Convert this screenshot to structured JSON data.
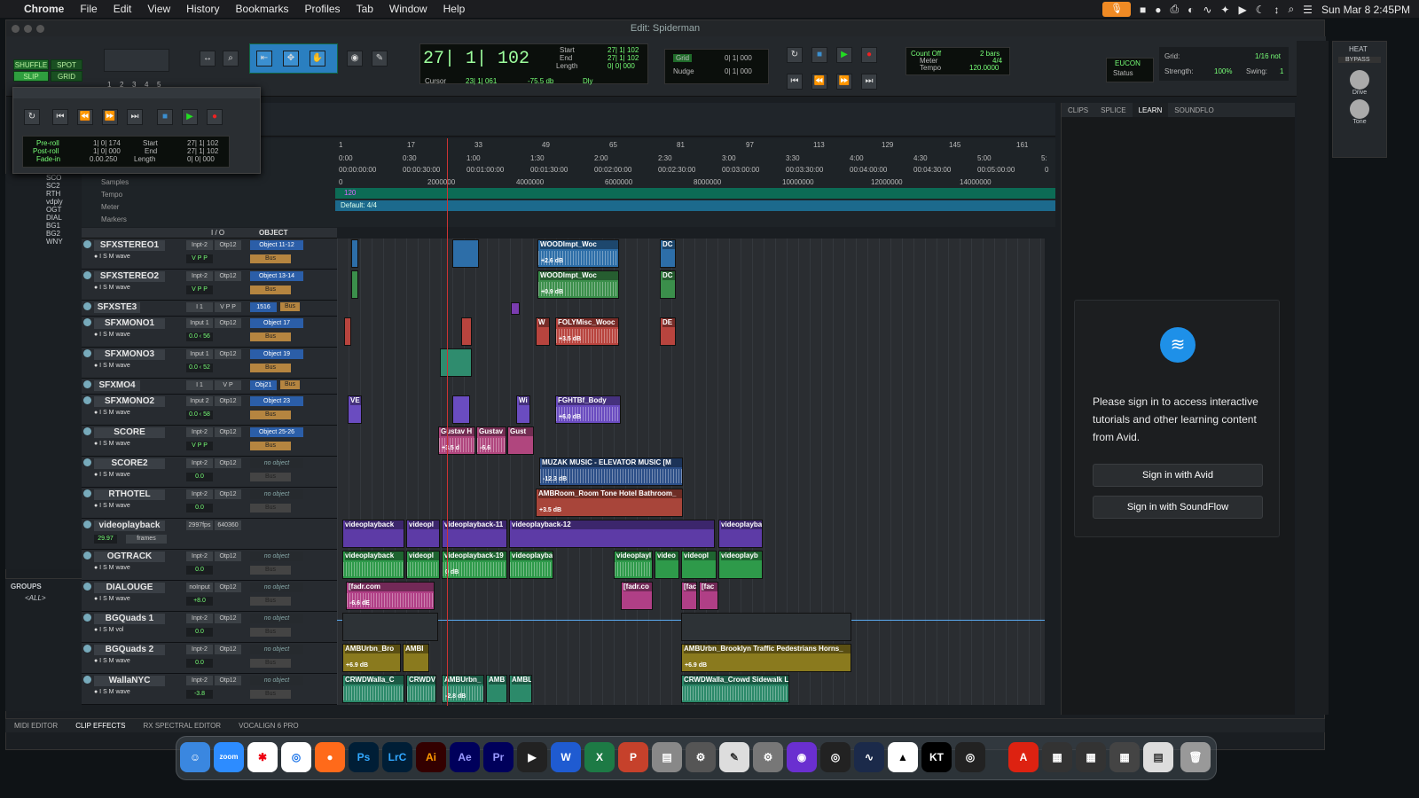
{
  "menubar": {
    "apple": "",
    "app": "Chrome",
    "items": [
      "File",
      "Edit",
      "View",
      "History",
      "Bookmarks",
      "Profiles",
      "Tab",
      "Window",
      "Help"
    ],
    "datetime": "Sun Mar 8  2:45PM"
  },
  "window": {
    "title": "Edit: Spiderman",
    "behind_title": "derman"
  },
  "toolbar": {
    "modes": {
      "shuffle": "SHUFFLE",
      "spot": "SPOT",
      "slip": "SLIP",
      "grid": "GRID"
    },
    "zoom_presets": [
      "1",
      "2",
      "3",
      "4",
      "5"
    ],
    "main_counter": "27| 1| 102",
    "start_label": "Start",
    "end_label": "End",
    "length_label": "Length",
    "start_val": "27| 1| 102",
    "end_val": "27| 1| 102",
    "length_val": "0| 0| 000",
    "cursor_label": "Cursor",
    "cursor_val": "23| 1| 061",
    "cursor_db": "-75.5 db",
    "dly": "Dly",
    "grid_label": "Grid",
    "grid_val": "0| 1| 000",
    "nudge_label": "Nudge",
    "nudge_val": "0| 1| 000",
    "count_off": "Count Off",
    "meter": "Meter",
    "tempo": "Tempo",
    "count_off_val": "2 bars",
    "meter_val": "4/4",
    "tempo_val": "120.0000",
    "eucon": "EUCON",
    "status": "Status",
    "grid2_label": "Grid:",
    "grid2_val": "1/16 not",
    "strength_label": "Strength:",
    "strength_val": "100%",
    "swing_label": "Swing:",
    "swing_val": "1"
  },
  "transport": {
    "preroll_label": "Pre-roll",
    "postroll_label": "Post-roll",
    "fadein_label": "Fade-in",
    "preroll_val": "1| 0| 174",
    "postroll_val": "1| 0| 000",
    "fadein_val": "0.00.250",
    "start_label": "Start",
    "end_label": "End",
    "length_label": "Length",
    "start_val": "27| 1| 102",
    "end_val": "27| 1| 102",
    "length_val": "0| 0| 000"
  },
  "ruler": {
    "labels": {
      "samples": "Samples",
      "tempo": "Tempo",
      "meter": "Meter",
      "markers": "Markers"
    },
    "bars": [
      "1",
      "17",
      "33",
      "49",
      "65",
      "81",
      "97",
      "113",
      "129",
      "145",
      "161"
    ],
    "mins": [
      "0:00",
      "0:30",
      "1:00",
      "1:30",
      "2:00",
      "2:30",
      "3:00",
      "3:30",
      "4:00",
      "4:30",
      "5:00",
      "5:"
    ],
    "tc": [
      "00:00:00:00",
      "00:00:30:00",
      "00:01:00:00",
      "00:01:30:00",
      "00:02:00:00",
      "00:02:30:00",
      "00:03:00:00",
      "00:03:30:00",
      "00:04:00:00",
      "00:04:30:00",
      "00:05:00:00",
      "0"
    ],
    "samples": [
      "0",
      "2000000",
      "4000000",
      "6000000",
      "8000000",
      "10000000",
      "12000000",
      "14000000"
    ],
    "tempo_val": "120",
    "meter_val": "Default: 4/4"
  },
  "cliplist": {
    "items": [
      "SCO",
      "SC2",
      "RTH",
      "vdply",
      "OGT",
      "DIAL",
      "BG1",
      "BG2",
      "WNY"
    ],
    "groups_label": "GROUPS",
    "all_group": "<ALL>"
  },
  "track_header": {
    "io": "I / O",
    "object": "OBJECT"
  },
  "tracks": [
    {
      "name": "SFXSTEREO1",
      "in": "Inpt-2",
      "out": "Otp12",
      "obj": "Object 11-12",
      "vol": "V P P",
      "bus": "Bus"
    },
    {
      "name": "SFXSTEREO2",
      "in": "Inpt-2",
      "out": "Otp12",
      "obj": "Object 13-14",
      "vol": "V P P",
      "bus": "Bus"
    },
    {
      "name": "SFXSTE3",
      "in": "I 1",
      "out": "V P P",
      "obj": "1516",
      "vol": "",
      "bus": "Bus"
    },
    {
      "name": "SFXMONO1",
      "in": "Input 1",
      "out": "Otp12",
      "obj": "Object 17",
      "vol": "0.0  ‹ 56",
      "bus": "Bus"
    },
    {
      "name": "SFXMONO3",
      "in": "Input 1",
      "out": "Otp12",
      "obj": "Object 19",
      "vol": "0.0  ‹ 52",
      "bus": "Bus"
    },
    {
      "name": "SFXMO4",
      "in": "I 1",
      "out": "V P",
      "obj": "Obj21",
      "vol": "",
      "bus": "Bus"
    },
    {
      "name": "SFXMONO2",
      "in": "Input 2",
      "out": "Otp12",
      "obj": "Object 23",
      "vol": "0.0  ‹ 58",
      "bus": "Bus"
    },
    {
      "name": "SCORE",
      "in": "Inpt-2",
      "out": "Otp12",
      "obj": "Object 25-26",
      "vol": "V P P",
      "bus": "Bus"
    },
    {
      "name": "SCORE2",
      "in": "Inpt-2",
      "out": "Otp12",
      "obj": "no object",
      "vol": "0.0",
      "bus": "Bus"
    },
    {
      "name": "RTHOTEL",
      "in": "Inpt-2",
      "out": "Otp12",
      "obj": "no object",
      "vol": "0.0",
      "bus": "Bus"
    },
    {
      "name": "videoplayback",
      "in": "2997fps",
      "out": "640360",
      "obj": "",
      "vol": "29.97",
      "bus": "frames"
    },
    {
      "name": "OGTRACK",
      "in": "Inpt-2",
      "out": "Otp12",
      "obj": "no object",
      "vol": "0.0",
      "bus": "Bus"
    },
    {
      "name": "DIALOUGE",
      "in": "noInput",
      "out": "Otp12",
      "obj": "no object",
      "vol": "+8.0",
      "bus": "Bus"
    },
    {
      "name": "BGQuads 1",
      "in": "Inpt-2",
      "out": "Otp12",
      "obj": "no object",
      "vol": "0.0",
      "bus": "Bus"
    },
    {
      "name": "BGQuads 2",
      "in": "Inpt-2",
      "out": "Otp12",
      "obj": "no object",
      "vol": "0.0",
      "bus": "Bus"
    },
    {
      "name": "WallaNYC",
      "in": "Inpt-2",
      "out": "Otp12",
      "obj": "no object",
      "vol": "-3.8",
      "bus": "Bus"
    }
  ],
  "clips": {
    "c1": "WOODImpt_Woc",
    "c1g": "+2.6 dB",
    "c2": "DC",
    "c3": "WOODImpt_Woc",
    "c3g": "+0.9 dB",
    "c4": "DC",
    "c5": "FOLYMisc_Wooc",
    "c5g": "+3.5 dB",
    "c6": "W",
    "c7": "DE",
    "c8": "VE",
    "c9": "Wi",
    "c10": "FGHTBf_Body",
    "c10g": "+6.0 dB",
    "c11": "Gustav H",
    "c11g": "+3.5 d",
    "c12": "Gustav",
    "c12g": "-6.6",
    "c13": "Gust",
    "c14": "MUZAK MUSIC - ELEVATOR MUSIC [M",
    "c14g": "-12.3 dB",
    "c15": "AMBRoom_Room Tone Hotel Bathroom_",
    "c15g": "+3.5 dB",
    "v1": "videoplayback",
    "v2": "videopl",
    "v3": "videoplayback-11",
    "v4": "videoplayback-12",
    "v5": "videoplayba",
    "o1": "videoplayback",
    "o2": "videopl",
    "o3": "videoplayback-19",
    "o4": "videoplayba",
    "o5": "videoplayl",
    "o6": "video",
    "o7": "videopl",
    "o8": "videoplayb",
    "odb": "0 dB",
    "d1": "[fadr.com",
    "d1g": "-6.6 dE",
    "d2": "[fadr.co",
    "d3": "[fac",
    "d4": "[fac",
    "b1": "AMBUrbn_Bro",
    "b2": "AMBI",
    "b1g": "+6.9 dB",
    "b3": "AMBUrbn_Brooklyn Traffic Pedestrians Horns_",
    "b3g": "+6.9 dB",
    "w1": "CRWDWalla_C",
    "w2": "CRWDV",
    "w3": "AMBUrbn_",
    "w4": "AMB",
    "w5": "AMBL",
    "w3g": "-2.8 dB",
    "w6": "CRWDWalla_Crowd Sidewalk L"
  },
  "rightpanel": {
    "tabs": [
      "CLIPS",
      "SPLICE",
      "LEARN",
      "SOUNDFLO"
    ],
    "active": "LEARN",
    "message": "Please sign in to access interactive tutorials and other learning content from Avid.",
    "btn_avid": "Sign in with Avid",
    "btn_soundflow": "Sign in with SoundFlow"
  },
  "heat": {
    "title": "HEAT",
    "bypass": "BYPASS",
    "drive": "Drive",
    "tone": "Tone"
  },
  "bottombar": [
    "MIDI EDITOR",
    "CLIP EFFECTS",
    "RX SPECTRAL EDITOR",
    "VOCALIGN 6 PRO"
  ],
  "dock": [
    "zoom",
    "Ps",
    "LrC",
    "Ai",
    "Ae",
    "Pr"
  ],
  "colors": {
    "accent_blue": "#2a7fc0",
    "grid_green": "#1f6b2a",
    "record_red": "#d22"
  }
}
